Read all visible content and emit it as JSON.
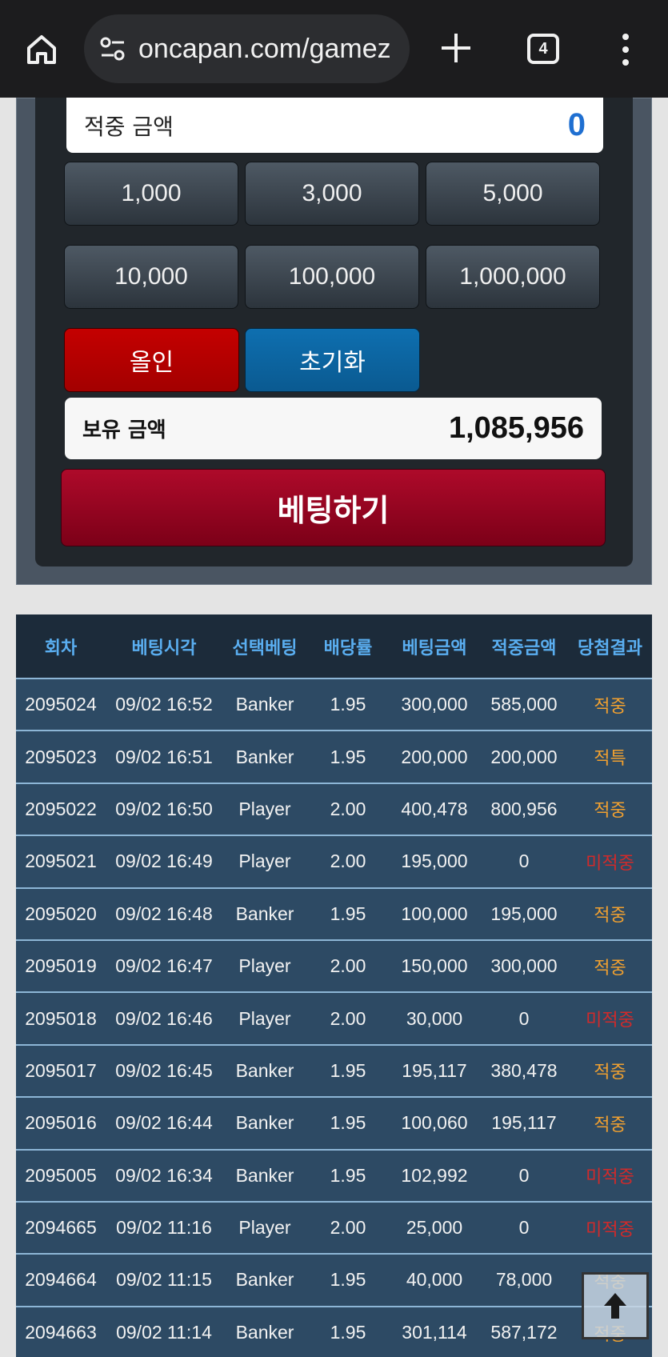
{
  "browser": {
    "url": "oncapan.com/gamez",
    "tab_count": "4"
  },
  "bet_panel": {
    "hit_amount_label": "적중 금액",
    "hit_amount_value": "0",
    "chips": [
      "1,000",
      "3,000",
      "5,000",
      "10,000",
      "100,000",
      "1,000,000"
    ],
    "allin_label": "올인",
    "reset_label": "초기화",
    "balance_label": "보유 금액",
    "balance_value": "1,085,956",
    "bet_button_label": "베팅하기"
  },
  "history": {
    "headers": [
      "회차",
      "베팅시각",
      "선택베팅",
      "배당률",
      "베팅금액",
      "적중금액",
      "당첨결과"
    ],
    "rows": [
      [
        "2095024",
        "09/02 16:52",
        "Banker",
        "1.95",
        "300,000",
        "585,000",
        "적중"
      ],
      [
        "2095023",
        "09/02 16:51",
        "Banker",
        "1.95",
        "200,000",
        "200,000",
        "적특"
      ],
      [
        "2095022",
        "09/02 16:50",
        "Player",
        "2.00",
        "400,478",
        "800,956",
        "적중"
      ],
      [
        "2095021",
        "09/02 16:49",
        "Player",
        "2.00",
        "195,000",
        "0",
        "미적중"
      ],
      [
        "2095020",
        "09/02 16:48",
        "Banker",
        "1.95",
        "100,000",
        "195,000",
        "적중"
      ],
      [
        "2095019",
        "09/02 16:47",
        "Player",
        "2.00",
        "150,000",
        "300,000",
        "적중"
      ],
      [
        "2095018",
        "09/02 16:46",
        "Player",
        "2.00",
        "30,000",
        "0",
        "미적중"
      ],
      [
        "2095017",
        "09/02 16:45",
        "Banker",
        "1.95",
        "195,117",
        "380,478",
        "적중"
      ],
      [
        "2095016",
        "09/02 16:44",
        "Banker",
        "1.95",
        "100,060",
        "195,117",
        "적중"
      ],
      [
        "2095005",
        "09/02 16:34",
        "Banker",
        "1.95",
        "102,992",
        "0",
        "미적중"
      ],
      [
        "2094665",
        "09/02 11:16",
        "Player",
        "2.00",
        "25,000",
        "0",
        "미적중"
      ],
      [
        "2094664",
        "09/02 11:15",
        "Banker",
        "1.95",
        "40,000",
        "78,000",
        "적중"
      ],
      [
        "2094663",
        "09/02 11:14",
        "Banker",
        "1.95",
        "301,114",
        "587,172",
        "적중"
      ]
    ],
    "result_colors": {
      "적중": "#f0a030",
      "적특": "#f0a030",
      "미적중": "#d12a2a"
    }
  }
}
